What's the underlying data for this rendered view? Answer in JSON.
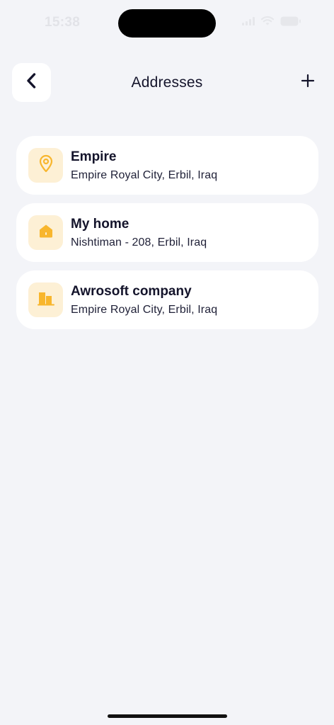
{
  "status_bar": {
    "time": "15:38"
  },
  "header": {
    "title": "Addresses"
  },
  "icons": {
    "back": "chevron-left-icon",
    "add": "plus-icon",
    "accent": "#f8b62d",
    "icon_bg": "#fdf0d5"
  },
  "addresses": [
    {
      "name": "Empire",
      "detail": "Empire Royal City, Erbil, Iraq",
      "icon": "location-pin-icon"
    },
    {
      "name": "My home",
      "detail": "Nishtiman - 208, Erbil, Iraq",
      "icon": "home-icon"
    },
    {
      "name": "Awrosoft company",
      "detail": "Empire Royal City, Erbil, Iraq",
      "icon": "building-icon"
    }
  ]
}
